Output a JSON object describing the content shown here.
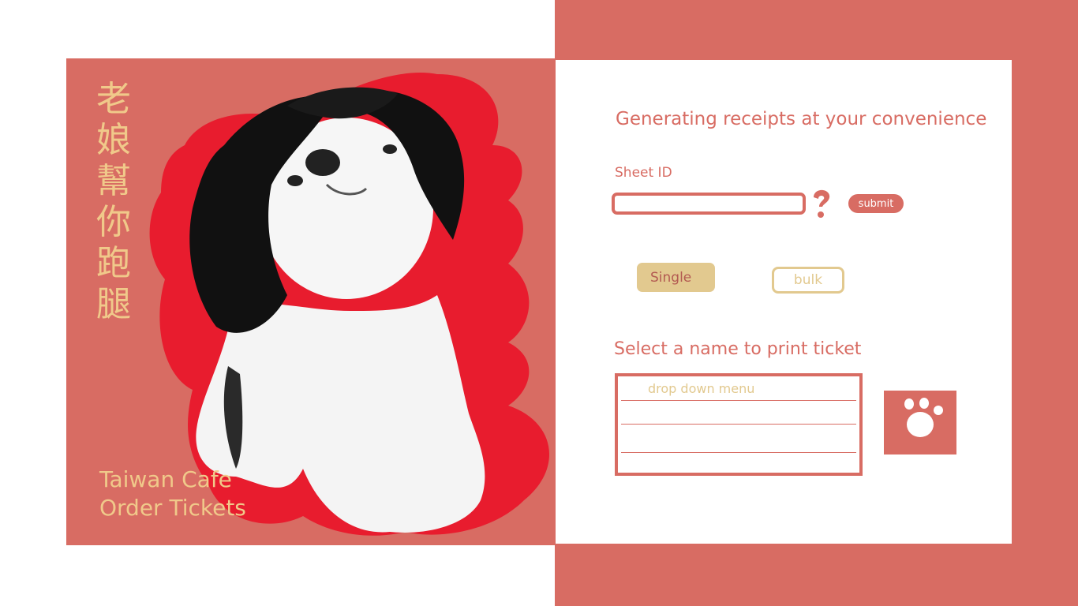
{
  "poster": {
    "vertical_title": [
      "老",
      "娘",
      "幫",
      "你",
      "跑",
      "腿"
    ],
    "title_line1": "Taiwan Cafe",
    "title_line2": "Order Tickets"
  },
  "form": {
    "heading": "Generating receipts at your convenience",
    "sheet_id_label": "Sheet ID",
    "sheet_id_value": "",
    "help_icon": "question-mark-icon",
    "submit_label": "submit",
    "single_label": "Single",
    "bulk_label": "bulk",
    "select_heading": "Select a name to print ticket",
    "dropdown_placeholder": "drop down menu",
    "print_icon": "paw-icon"
  },
  "colors": {
    "accent": "#d86c63",
    "gold": "#e2c98f",
    "poster_text": "#f0c98a"
  }
}
